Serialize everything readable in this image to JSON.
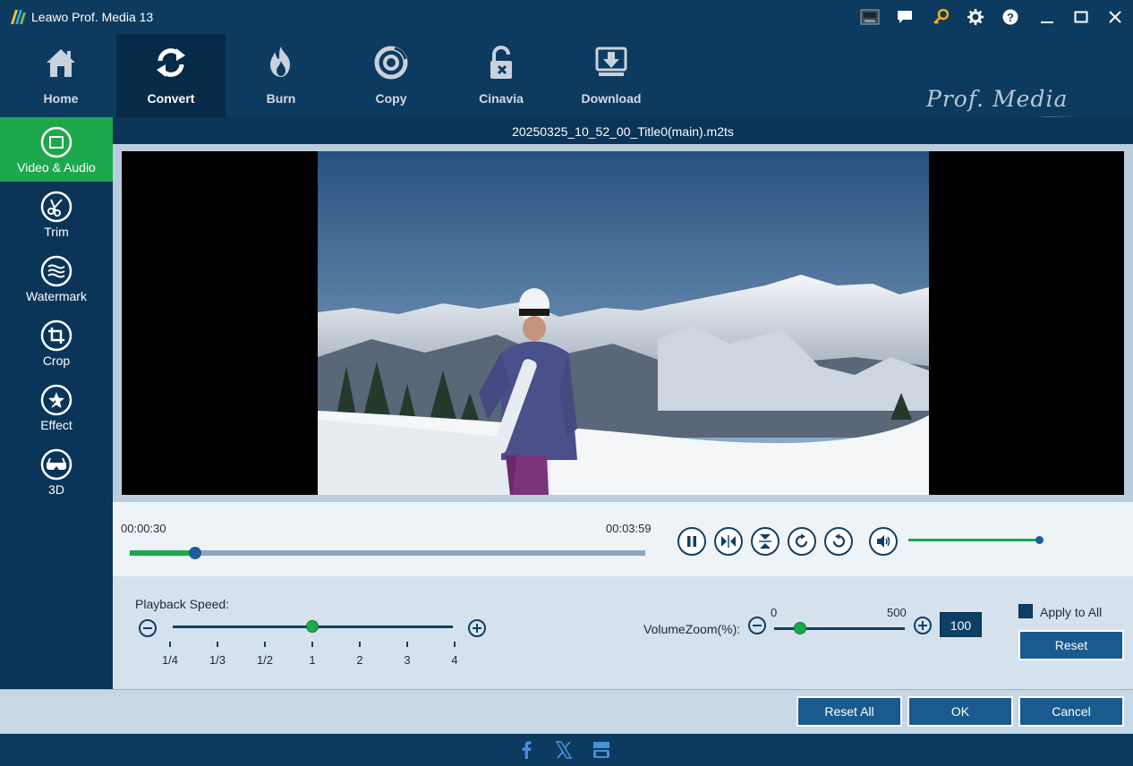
{
  "window": {
    "title": "Leawo Prof. Media 13",
    "brand_text": "Prof. Media"
  },
  "toolbar": {
    "tabs": [
      {
        "label": "Home",
        "icon": "home-icon"
      },
      {
        "label": "Convert",
        "icon": "convert-icon",
        "active": true
      },
      {
        "label": "Burn",
        "icon": "burn-icon"
      },
      {
        "label": "Copy",
        "icon": "copy-icon"
      },
      {
        "label": "Cinavia",
        "icon": "cinavia-icon"
      },
      {
        "label": "Download",
        "icon": "download-icon"
      }
    ]
  },
  "sidebar": {
    "items": [
      {
        "label": "Video & Audio",
        "icon": "video-audio-icon",
        "active": true
      },
      {
        "label": "Trim",
        "icon": "trim-icon"
      },
      {
        "label": "Watermark",
        "icon": "watermark-icon"
      },
      {
        "label": "Crop",
        "icon": "crop-icon"
      },
      {
        "label": "Effect",
        "icon": "effect-icon"
      },
      {
        "label": "3D",
        "icon": "3d-icon"
      }
    ]
  },
  "file": {
    "name": "20250325_10_52_00_Title0(main).m2ts"
  },
  "player": {
    "current_time": "00:00:30",
    "total_time": "00:03:59",
    "progress_fraction": 0.126,
    "volume_fraction": 1.0
  },
  "settings": {
    "playback_speed_label": "Playback Speed:",
    "speed_ticks": [
      "1/4",
      "1/3",
      "1/2",
      "1",
      "2",
      "3",
      "4"
    ],
    "speed_selected": "1",
    "volume_zoom_label": "VolumeZoom(%):",
    "volume_zoom_min": "0",
    "volume_zoom_max": "500",
    "volume_zoom_value": "100",
    "apply_to_all_label": "Apply to All",
    "reset_label": "Reset"
  },
  "footer": {
    "reset_all_label": "Reset All",
    "ok_label": "OK",
    "cancel_label": "Cancel"
  },
  "colors": {
    "accent_green": "#1da84d",
    "dark_blue": "#0d3a5f",
    "button_blue": "#1a5a8e"
  }
}
